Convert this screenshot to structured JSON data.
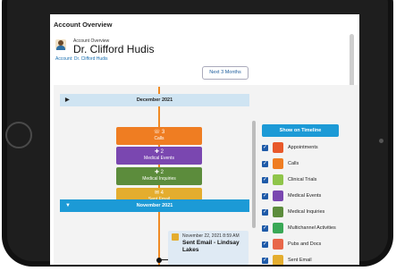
{
  "page": {
    "title": "Account Overview"
  },
  "header": {
    "subtitle": "Account Overview",
    "name": "Dr. Clifford Hudis",
    "account_link": "Account: Dr. Clifford Hudis"
  },
  "toolbar": {
    "range_button": "Next 3 Months"
  },
  "timeline": {
    "december": {
      "label": "December 2021",
      "arrow": "▶"
    },
    "november": {
      "label": "November 2021",
      "arrow": "▼"
    },
    "cards": [
      {
        "count": "3",
        "label": "Calls",
        "color": "#ef7d22"
      },
      {
        "count": "2",
        "label": "Medical Events",
        "color": "#7a47b0"
      },
      {
        "count": "2",
        "label": "Medical Inquiries",
        "color": "#5c8c3c"
      },
      {
        "count": "4",
        "label": "Sent Email",
        "color": "#e4ad2e"
      }
    ],
    "event": {
      "date": "November 22, 2021 8:59 AM",
      "title": "Sent Email - Lindsay Lakes"
    }
  },
  "filters": {
    "button": "Show on Timeline",
    "items": [
      {
        "label": "Appointments",
        "checked": true,
        "icon": "calendar-icon",
        "color": "#e8592a"
      },
      {
        "label": "Calls",
        "checked": true,
        "icon": "call-icon",
        "color": "#ef7d22"
      },
      {
        "label": "Clinical Trials",
        "checked": true,
        "icon": "trials-icon",
        "color": "#8fc54a"
      },
      {
        "label": "Medical Events",
        "checked": true,
        "icon": "medical-event-icon",
        "color": "#7a47b0"
      },
      {
        "label": "Medical Inquiries",
        "checked": true,
        "icon": "inquiry-icon",
        "color": "#5c8c3c"
      },
      {
        "label": "Multichannel Activities",
        "checked": true,
        "icon": "multichannel-icon",
        "color": "#3aa856"
      },
      {
        "label": "Pubs and Docs",
        "checked": true,
        "icon": "docs-icon",
        "color": "#e8674a"
      },
      {
        "label": "Sent Email",
        "checked": true,
        "icon": "email-icon",
        "color": "#e4ad2e"
      }
    ]
  }
}
